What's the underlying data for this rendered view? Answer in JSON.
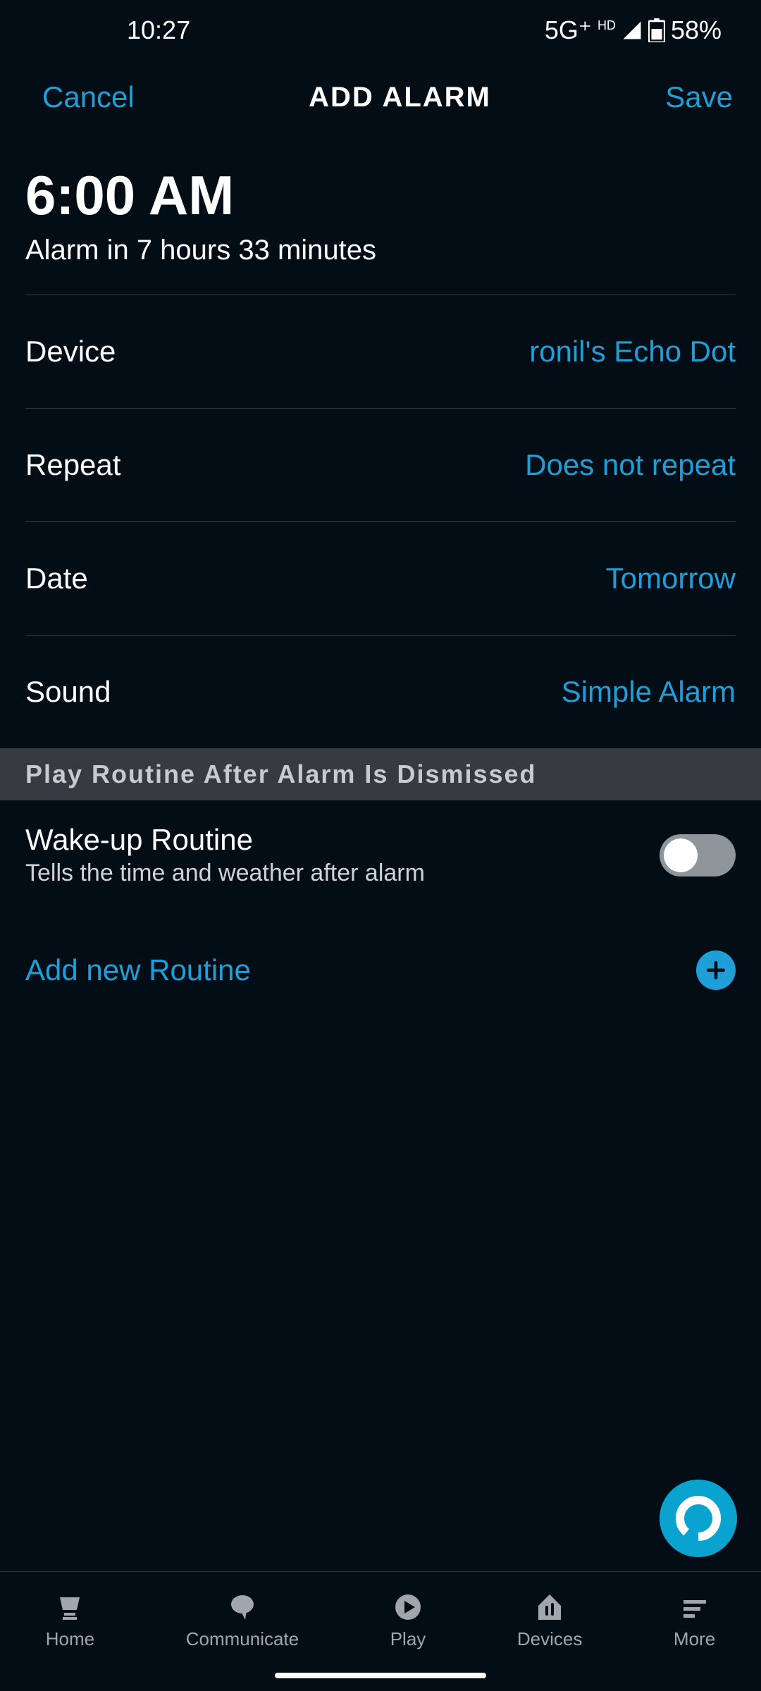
{
  "status": {
    "time": "10:27",
    "network": "5G⁺",
    "battery": "58%"
  },
  "header": {
    "cancel": "Cancel",
    "title": "ADD ALARM",
    "save": "Save"
  },
  "alarm": {
    "time": "6:00 AM",
    "countdown": "Alarm in 7 hours 33 minutes"
  },
  "rows": {
    "device": {
      "label": "Device",
      "value": "ronil's Echo Dot"
    },
    "repeat": {
      "label": "Repeat",
      "value": "Does not repeat"
    },
    "date": {
      "label": "Date",
      "value": "Tomorrow"
    },
    "sound": {
      "label": "Sound",
      "value": "Simple Alarm"
    }
  },
  "sectionHeader": "Play Routine After Alarm Is Dismissed",
  "routine": {
    "title": "Wake-up Routine",
    "sub": "Tells the time and weather after alarm"
  },
  "addRoutine": "Add new Routine",
  "nav": {
    "home": "Home",
    "communicate": "Communicate",
    "play": "Play",
    "devices": "Devices",
    "more": "More"
  }
}
